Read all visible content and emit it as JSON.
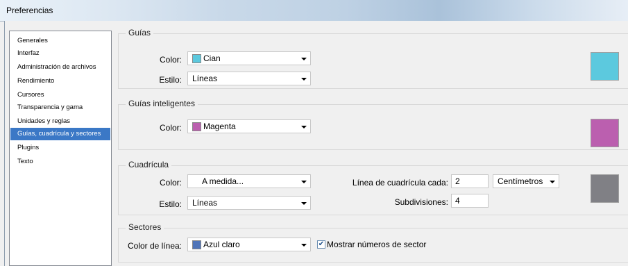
{
  "window": {
    "title": "Preferencias"
  },
  "sidebar": {
    "items": [
      {
        "label": "Generales"
      },
      {
        "label": "Interfaz"
      },
      {
        "label": "Administración de archivos"
      },
      {
        "label": "Rendimiento"
      },
      {
        "label": "Cursores"
      },
      {
        "label": "Transparencia y gama"
      },
      {
        "label": "Unidades y reglas"
      },
      {
        "label": "Guías, cuadrícula y sectores",
        "selected": true
      },
      {
        "label": "Plugins"
      },
      {
        "label": "Texto"
      }
    ]
  },
  "guias": {
    "legend": "Guías",
    "color_label": "Color:",
    "color_value": "Cian",
    "color_hex": "#5cc9de",
    "estilo_label": "Estilo:",
    "estilo_value": "Líneas"
  },
  "guias_inteligentes": {
    "legend": "Guías inteligentes",
    "color_label": "Color:",
    "color_value": "Magenta",
    "color_hex": "#bb5faf"
  },
  "cuadricula": {
    "legend": "Cuadrícula",
    "color_label": "Color:",
    "color_value": "A medida...",
    "color_hex": "#808085",
    "estilo_label": "Estilo:",
    "estilo_value": "Líneas",
    "linea_label": "Línea de cuadrícula cada:",
    "linea_value": "2",
    "unidad_value": "Centímetros",
    "subdiv_label": "Subdivisiones:",
    "subdiv_value": "4"
  },
  "sectores": {
    "legend": "Sectores",
    "color_label": "Color de línea:",
    "color_value": "Azul claro",
    "color_hex": "#4f74b8",
    "mostrar_label": "Mostrar números de sector",
    "mostrar_checked": true
  }
}
